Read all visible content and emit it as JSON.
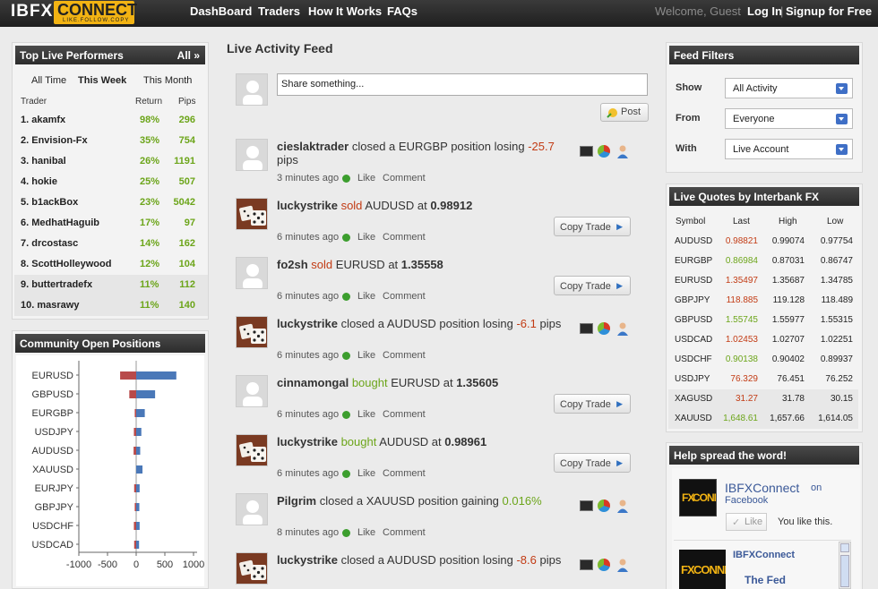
{
  "brand": {
    "name_a": "IBFX",
    "name_b": "CONNECT",
    "tagline": "LIKE.FOLLOW.COPY"
  },
  "nav": {
    "items": [
      "DashBoard",
      "Traders",
      "How It Works",
      "FAQs"
    ]
  },
  "account": {
    "welcome": "Welcome, Guest",
    "login": "Log In",
    "separator": "|",
    "signup": "Signup for Free"
  },
  "performers": {
    "title": "Top Live Performers",
    "all": "All »",
    "tabs": [
      "All Time",
      "This Week",
      "This Month"
    ],
    "active_tab": "This Week",
    "columns": [
      "Trader",
      "Return",
      "Pips"
    ],
    "rows": [
      {
        "name": "1. akamfx",
        "ret": "98%",
        "pips": "296"
      },
      {
        "name": "2. Envision-Fx",
        "ret": "35%",
        "pips": "754"
      },
      {
        "name": "3. hanibal",
        "ret": "26%",
        "pips": "1191"
      },
      {
        "name": "4. hokie",
        "ret": "25%",
        "pips": "507"
      },
      {
        "name": "5. b1ackBox",
        "ret": "23%",
        "pips": "5042"
      },
      {
        "name": "6. MedhatHaguib",
        "ret": "17%",
        "pips": "97"
      },
      {
        "name": "7. drcostasc",
        "ret": "14%",
        "pips": "162"
      },
      {
        "name": "8. ScottHolleywood",
        "ret": "12%",
        "pips": "104"
      },
      {
        "name": "9. buttertradefx",
        "ret": "11%",
        "pips": "112"
      },
      {
        "name": "10. masrawy",
        "ret": "11%",
        "pips": "140"
      }
    ]
  },
  "positions": {
    "title": "Community Open Positions"
  },
  "chart_data": {
    "type": "bar",
    "orientation": "horizontal",
    "categories": [
      "EURUSD",
      "GBPUSD",
      "EURGBP",
      "USDJPY",
      "AUDUSD",
      "XAUUSD",
      "EURJPY",
      "GBPJPY",
      "USDCHF",
      "USDCAD"
    ],
    "series": [
      {
        "values": [
          -280,
          -120,
          -25,
          -40,
          -45,
          5,
          -35,
          -25,
          -40,
          -35
        ],
        "color": "#b84a4a"
      },
      {
        "values": [
          700,
          330,
          150,
          90,
          70,
          110,
          60,
          55,
          60,
          50
        ],
        "color": "#4a78b8"
      }
    ],
    "xlim": [
      -1000,
      1000
    ],
    "xticks": [
      "-1000",
      "-500",
      "0",
      "500",
      "1000"
    ]
  },
  "feed": {
    "title": "Live Activity Feed",
    "share_placeholder": "Share something...",
    "post_label": "Post",
    "like_label": "Like",
    "comment_label": "Comment",
    "copy_label": "Copy Trade",
    "items": [
      {
        "user": "cieslaktrader",
        "verb": "closed a",
        "sym": "EURGBP",
        "mid": "position losing",
        "val": "-25.7",
        "tail": "pips",
        "time": "3 minutes ago"
      },
      {
        "user": "luckystrike",
        "verb": "sold",
        "sym": "AUDUSD",
        "mid": "at",
        "val": "0.98912",
        "time": "6 minutes ago"
      },
      {
        "user": "fo2sh",
        "verb": "sold",
        "sym": "EURUSD",
        "mid": "at",
        "val": "1.35558",
        "time": "6 minutes ago"
      },
      {
        "user": "luckystrike",
        "verb": "closed a",
        "sym": "AUDUSD",
        "mid": "position losing",
        "val": "-6.1",
        "tail": "pips",
        "time": "6 minutes ago"
      },
      {
        "user": "cinnamongal",
        "verb": "bought",
        "sym": "EURUSD",
        "mid": "at",
        "val": "1.35605",
        "time": "6 minutes ago"
      },
      {
        "user": "luckystrike",
        "verb": "bought",
        "sym": "AUDUSD",
        "mid": "at",
        "val": "0.98961",
        "time": "6 minutes ago"
      },
      {
        "user": "Pilgrim",
        "verb": "closed a",
        "sym": "XAUUSD",
        "mid": "position gaining",
        "val": "0.016%",
        "time": "8 minutes ago"
      },
      {
        "user": "luckystrike",
        "verb": "closed a",
        "sym": "AUDUSD",
        "mid": "position losing",
        "val": "-8.6",
        "tail": "pips",
        "time": ""
      }
    ]
  },
  "filters": {
    "title": "Feed Filters",
    "show_label": "Show",
    "show_value": "All Activity",
    "from_label": "From",
    "from_value": "Everyone",
    "with_label": "With",
    "with_value": "Live Account"
  },
  "quotes": {
    "title": "Live Quotes by Interbank FX",
    "columns": [
      "Symbol",
      "Last",
      "High",
      "Low"
    ],
    "rows": [
      {
        "sym": "AUDUSD",
        "last": "0.98821",
        "dir": "dn",
        "high": "0.99074",
        "low": "0.97754"
      },
      {
        "sym": "EURGBP",
        "last": "0.86984",
        "dir": "up",
        "high": "0.87031",
        "low": "0.86747"
      },
      {
        "sym": "EURUSD",
        "last": "1.35497",
        "dir": "dn",
        "high": "1.35687",
        "low": "1.34785"
      },
      {
        "sym": "GBPJPY",
        "last": "118.885",
        "dir": "dn",
        "high": "119.128",
        "low": "118.489"
      },
      {
        "sym": "GBPUSD",
        "last": "1.55745",
        "dir": "up",
        "high": "1.55977",
        "low": "1.55315"
      },
      {
        "sym": "USDCAD",
        "last": "1.02453",
        "dir": "dn",
        "high": "1.02707",
        "low": "1.02251"
      },
      {
        "sym": "USDCHF",
        "last": "0.90138",
        "dir": "up",
        "high": "0.90402",
        "low": "0.89937"
      },
      {
        "sym": "USDJPY",
        "last": "76.329",
        "dir": "dn",
        "high": "76.451",
        "low": "76.252"
      },
      {
        "sym": "XAGUSD",
        "last": "31.27",
        "dir": "dn",
        "high": "31.78",
        "low": "30.15"
      },
      {
        "sym": "XAUUSD",
        "last": "1,648.61",
        "dir": "up",
        "high": "1,657.66",
        "low": "1,614.05"
      }
    ]
  },
  "spread": {
    "title": "Help spread the word!",
    "fb_page": "IBFXConnect",
    "fb_on": "on",
    "fb_site": "Facebook",
    "like_btn": "Like",
    "you_like": "You like this.",
    "feed_user": "IBFXConnect",
    "feed_headline": "The Fed"
  },
  "colors": {
    "accent": "#f2b313",
    "gain": "#6ca51a",
    "loss": "#c23b14",
    "header": "#2c2c2c"
  }
}
